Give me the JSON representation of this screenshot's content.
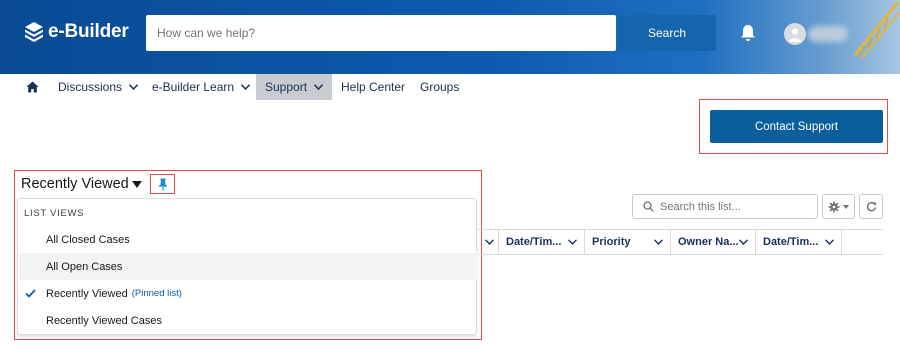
{
  "header": {
    "brand": "e-Builder",
    "search_placeholder": "How can we help?",
    "search_button": "Search"
  },
  "nav": {
    "items": [
      {
        "label": "Discussions",
        "has_dropdown": true
      },
      {
        "label": "e-Builder Learn",
        "has_dropdown": true
      },
      {
        "label": "Support",
        "has_dropdown": true,
        "active": true
      },
      {
        "label": "Help Center",
        "has_dropdown": false
      },
      {
        "label": "Groups",
        "has_dropdown": false
      }
    ]
  },
  "contact_support": "Contact Support",
  "list_view": {
    "title": "Recently Viewed",
    "dropdown_heading": "LIST VIEWS",
    "items": [
      {
        "label": "All Closed Cases"
      },
      {
        "label": "All Open Cases"
      },
      {
        "label": "Recently Viewed",
        "note": "(Pinned list)",
        "checked": true
      },
      {
        "label": "Recently Viewed Cases"
      }
    ]
  },
  "list_controls": {
    "search_placeholder": "Search this list..."
  },
  "table": {
    "columns": [
      "Date/Tim...",
      "Priority",
      "Owner Na...",
      "Date/Tim..."
    ]
  },
  "colors": {
    "header_blue": "#0a4a94",
    "button_blue": "#0b5e9c",
    "highlight_red": "#e04b4b",
    "nav_text": "#1b2f52"
  }
}
